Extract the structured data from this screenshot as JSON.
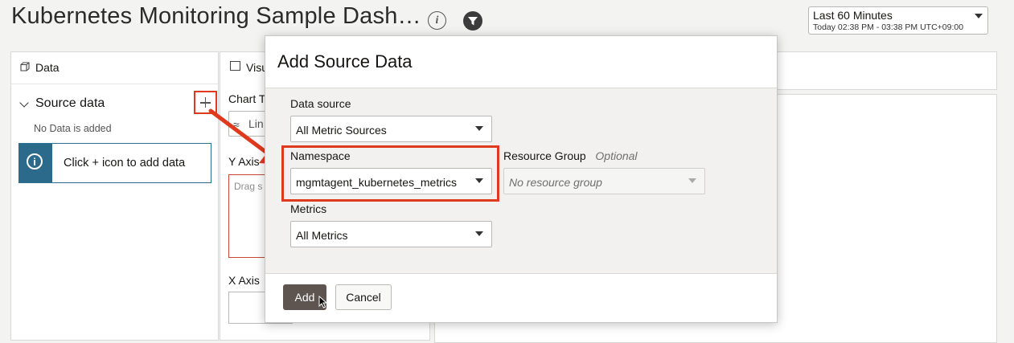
{
  "header": {
    "title": "Kubernetes Monitoring Sample Dash…",
    "time_range": {
      "label": "Last 60 Minutes",
      "detail": "Today 02:38 PM - 03:38 PM UTC+09:00"
    }
  },
  "data_panel": {
    "header": "Data",
    "section": "Source data",
    "empty_text": "No Data is added",
    "hint": "Click + icon to add data"
  },
  "visual_panel": {
    "header": "Visu",
    "chart_type_label": "Chart T",
    "chart_type_value": "Lin",
    "y_axis_label": "Y Axis",
    "y_axis_placeholder": "Drag s",
    "x_axis_label": "X Axis"
  },
  "dialog": {
    "title": "Add Source Data",
    "data_source": {
      "label": "Data source",
      "value": "All Metric Sources"
    },
    "namespace": {
      "label": "Namespace",
      "value": "mgmtagent_kubernetes_metrics"
    },
    "resource_group": {
      "label": "Resource Group",
      "optional": "Optional",
      "placeholder": "No resource group"
    },
    "metrics": {
      "label": "Metrics",
      "value": "All Metrics"
    },
    "add_button": "Add",
    "cancel_button": "Cancel"
  },
  "colors": {
    "highlight": "#e03a1e",
    "primary_button": "#5e5551",
    "info_accent": "#2b6a8a"
  }
}
